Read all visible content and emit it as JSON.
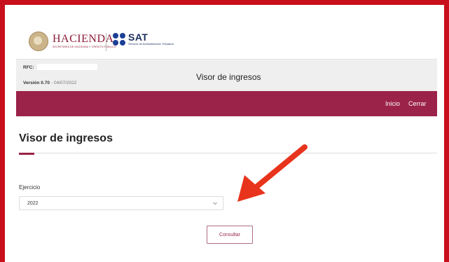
{
  "brand": {
    "hacienda_name": "HACIENDA",
    "hacienda_subtitle": "SECRETARÍA DE HACIENDA Y CRÉDITO PÚBLICO",
    "sat_name": "SAT",
    "sat_subtitle": "Servicio de Administración Tributaria"
  },
  "info": {
    "rfc_label": "RFC:",
    "rfc_value": "",
    "version_label": "Versión 0.70",
    "version_value": "- 04/07/2022",
    "app_title": "Visor de ingresos"
  },
  "nav": {
    "inicio": "Inicio",
    "cerrar": "Cerrar"
  },
  "page": {
    "title": "Visor de ingresos"
  },
  "form": {
    "ejercicio_label": "Ejercicio",
    "ejercicio_value": "2022",
    "consultar_label": "Consultar"
  },
  "colors": {
    "frame": "#c8101c",
    "brand_maroon": "#9b2248",
    "sat_blue": "#1c3f95",
    "arrow": "#e8341c"
  },
  "annotation": {
    "arrow_icon": "red-arrow-icon"
  }
}
